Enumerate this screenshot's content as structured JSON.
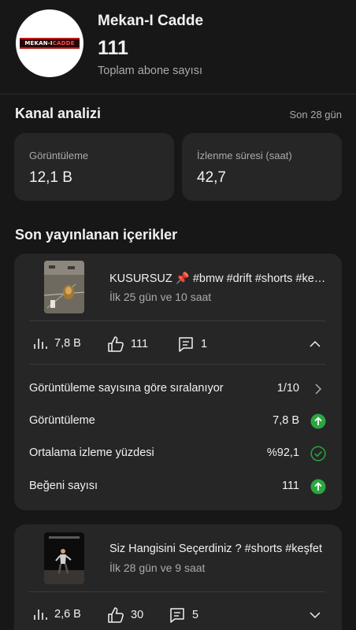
{
  "channel": {
    "name": "Mekan-I Cadde",
    "logo_text_white": "MEKAN-I",
    "logo_text_red": "CADDE",
    "subscribers": "111",
    "subscribers_label": "Toplam abone sayısı"
  },
  "analytics": {
    "title": "Kanal analizi",
    "period": "Son 28 gün",
    "views_label": "Görüntüleme",
    "views_value": "12,1 B",
    "watch_label": "İzlenme süresi (saat)",
    "watch_value": "42,7"
  },
  "recent": {
    "title": "Son yayınlanan içerikler",
    "videos": [
      {
        "title": "KUSURSUZ 📌 #bmw #drift #shorts #keşfet",
        "subtitle": "İlk 25 gün ve 10 saat",
        "views": "7,8 B",
        "likes": "111",
        "comments": "1",
        "expanded": true,
        "details": {
          "sort_label": "Görüntüleme sayısına göre sıralanıyor",
          "rank": "1/10",
          "rows": [
            {
              "label": "Görüntüleme",
              "value": "7,8 B",
              "icon": "arrow-up-green-icon"
            },
            {
              "label": "Ortalama izleme yüzdesi",
              "value": "%92,1",
              "icon": "check-circle-icon"
            },
            {
              "label": "Beğeni sayısı",
              "value": "111",
              "icon": "arrow-up-green-icon"
            }
          ]
        }
      },
      {
        "title": "Siz Hangisini Seçerdiniz ? #shorts #keşfet",
        "subtitle": "İlk 28 gün ve 9 saat",
        "views": "2,6 B",
        "likes": "30",
        "comments": "5",
        "expanded": false
      }
    ]
  },
  "colors": {
    "background": "#171717",
    "card": "#262626",
    "accent_green": "#2ba640",
    "secondary_text": "#aaaaaa"
  }
}
